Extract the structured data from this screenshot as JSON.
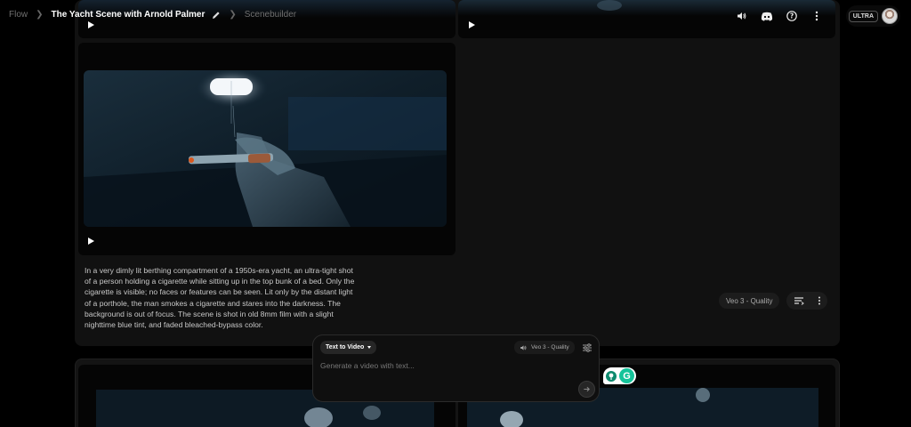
{
  "breadcrumb": {
    "root": "Flow",
    "project": "The Yacht Scene with Arnold Palmer",
    "section": "Scenebuilder"
  },
  "header": {
    "plan_badge": "ULTRA",
    "icons": [
      "volume-icon",
      "discord-icon",
      "help-icon",
      "more-vert-icon"
    ]
  },
  "scene": {
    "prompt": "In a very dimly lit berthing compartment of a 1950s-era yacht, an ultra-tight shot of a person holding a cigarette while sitting up in the top bunk of a bed. Only the cigarette is visible; no faces or features can be seen. Lit only by the distant light of a porthole, the man smokes a cigarette and stares into the darkness. The background is out of focus. The scene is shot in old 8mm film with a slight nighttime blue tint, and faded bleached-bypass color.",
    "model_label": "Veo 3 - Quality"
  },
  "composer": {
    "mode_label": "Text to Video",
    "model_label": "Veo 3 - Quality",
    "placeholder": "Generate a video with text..."
  },
  "colors": {
    "background": "#000000",
    "panel": "#111111",
    "extension_green": "#15c39a"
  }
}
